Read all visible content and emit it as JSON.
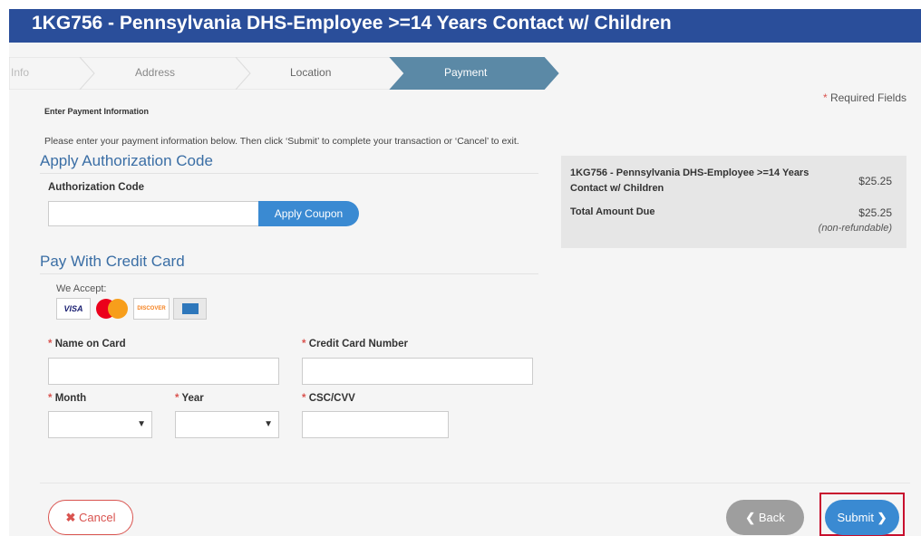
{
  "header": {
    "title": "1KG756 - Pennsylvania DHS-Employee >=14 Years Contact w/ Children"
  },
  "steps": [
    {
      "label": "Info",
      "state": "done"
    },
    {
      "label": "Address",
      "state": "done"
    },
    {
      "label": "Location",
      "state": "done"
    },
    {
      "label": "Payment",
      "state": "active"
    }
  ],
  "required_note": {
    "star": "*",
    "text": " Required Fields"
  },
  "payment": {
    "section_title": "Enter Payment Information",
    "instructions": "Please enter your payment information below. Then click ‘Submit’ to complete your transaction or ‘Cancel’ to exit."
  },
  "auth": {
    "heading": "Apply Authorization Code",
    "field_label": "Authorization Code",
    "field_value": "",
    "apply_label": "Apply Coupon"
  },
  "card": {
    "heading": "Pay With Credit Card",
    "we_accept": "We Accept:",
    "cards": [
      {
        "name": "VISA",
        "icon": "visa-icon",
        "color": "#1a1f71"
      },
      {
        "name": "MasterCard",
        "icon": "mastercard-icon",
        "color": "#eb001b"
      },
      {
        "name": "DISCOVER",
        "icon": "discover-icon",
        "color": "#f58220"
      },
      {
        "name": "AMERICAN EXPRESS",
        "icon": "amex-icon",
        "color": "#2e77bb"
      }
    ],
    "name_label": "Name on Card",
    "number_label": "Credit Card Number",
    "month_label": "Month",
    "year_label": "Year",
    "cvv_label": "CSC/CVV",
    "star": "*"
  },
  "summary": {
    "item": "1KG756 - Pennsylvania DHS-Employee >=14 Years Contact w/ Children",
    "item_price": "$25.25",
    "total_label": "Total Amount Due",
    "total_value": "$25.25",
    "note": "(non-refundable)"
  },
  "buttons": {
    "cancel": "Cancel",
    "back": "Back",
    "submit": "Submit"
  },
  "colors": {
    "header_bg": "#2a4e9a",
    "step_active": "#5b89a6",
    "accent_blue": "#3a8ad2",
    "danger": "#d9534f",
    "back_grey": "#9e9e9e"
  }
}
